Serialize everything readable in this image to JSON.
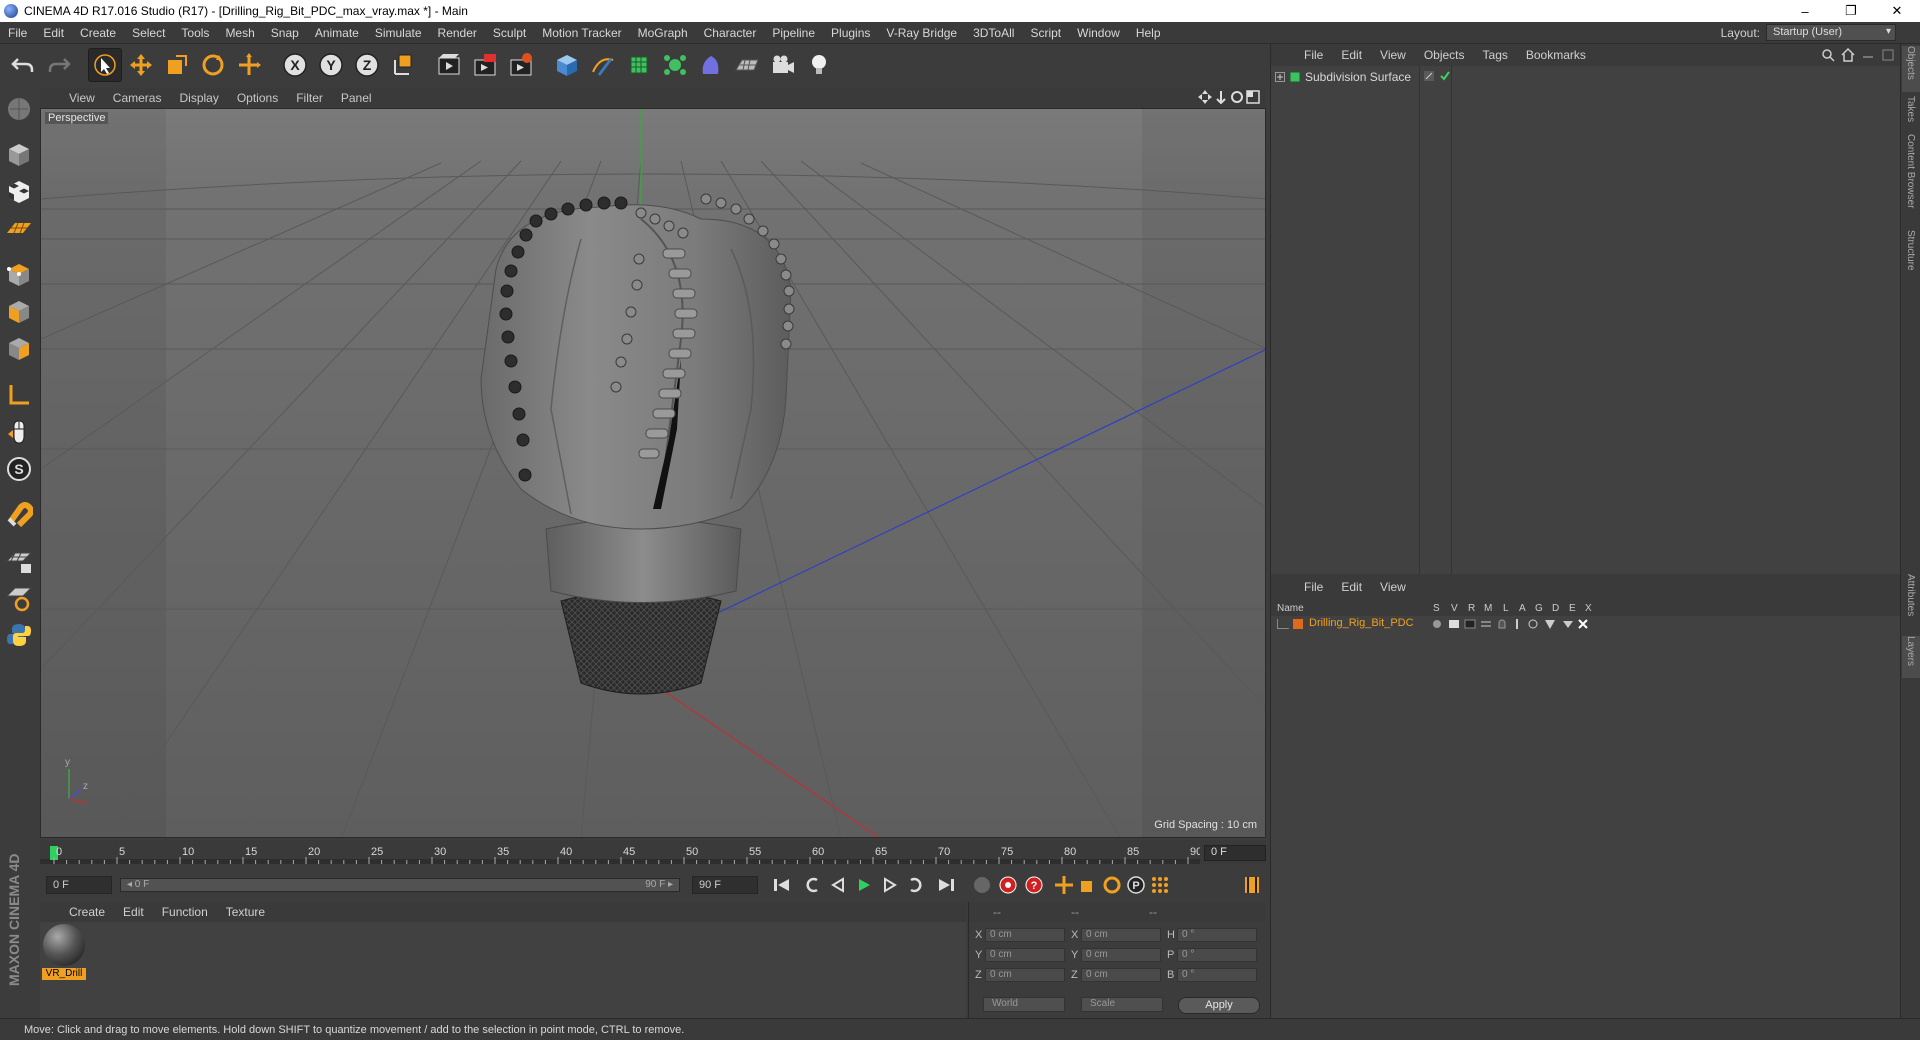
{
  "window": {
    "title": "CINEMA 4D R17.016 Studio (R17) - [Drilling_Rig_Bit_PDC_max_vray.max *] - Main",
    "minimize": "–",
    "maximize": "❐",
    "close": "✕"
  },
  "menubar": {
    "items": [
      "File",
      "Edit",
      "Create",
      "Select",
      "Tools",
      "Mesh",
      "Snap",
      "Animate",
      "Simulate",
      "Render",
      "Sculpt",
      "Motion Tracker",
      "MoGraph",
      "Character",
      "Pipeline",
      "Plugins",
      "V-Ray Bridge",
      "3DToAll",
      "Script",
      "Window",
      "Help"
    ],
    "layout_label": "Layout:",
    "layout_value": "Startup (User)"
  },
  "viewport": {
    "menu": [
      "View",
      "Cameras",
      "Display",
      "Options",
      "Filter",
      "Panel"
    ],
    "label": "Perspective",
    "grid_spacing": "Grid Spacing : 10 cm",
    "axis_y": "y",
    "axis_z": "z"
  },
  "timeline": {
    "ticks": [
      "0",
      "5",
      "10",
      "15",
      "20",
      "25",
      "30",
      "35",
      "40",
      "45",
      "50",
      "55",
      "60",
      "65",
      "70",
      "75",
      "80",
      "85",
      "90"
    ],
    "current_frame": "0 F",
    "start_field": "0 F",
    "range_start": "◂ 0 F",
    "range_end": "90 F ▸",
    "end_field": "90 F"
  },
  "material_manager": {
    "menu": [
      "Create",
      "Edit",
      "Function",
      "Texture"
    ],
    "materials": [
      {
        "name": "VR_Drill"
      }
    ]
  },
  "coordinates": {
    "header": [
      "--",
      "--",
      "--"
    ],
    "rows": [
      {
        "l1": "X",
        "v1": "0 cm",
        "l2": "X",
        "v2": "0 cm",
        "l3": "H",
        "v3": "0 °"
      },
      {
        "l1": "Y",
        "v1": "0 cm",
        "l2": "Y",
        "v2": "0 cm",
        "l3": "P",
        "v3": "0 °"
      },
      {
        "l1": "Z",
        "v1": "0 cm",
        "l2": "Z",
        "v2": "0 cm",
        "l3": "B",
        "v3": "0 °"
      }
    ],
    "space_select": "World",
    "mode_select": "Scale",
    "apply": "Apply"
  },
  "object_manager": {
    "menu": [
      "File",
      "Edit",
      "View",
      "Objects",
      "Tags",
      "Bookmarks"
    ],
    "objects": [
      {
        "name": "Subdivision Surface"
      }
    ]
  },
  "layer_manager": {
    "menu": [
      "File",
      "Edit",
      "View"
    ],
    "columns": [
      "Name",
      "S",
      "V",
      "R",
      "M",
      "L",
      "A",
      "G",
      "D",
      "E",
      "X"
    ],
    "layers": [
      {
        "name": "Drilling_Rig_Bit_PDC",
        "color": "#e06a1a"
      }
    ]
  },
  "side_tabs": [
    "Objects",
    "Takes",
    "Content Browser",
    "Structure",
    "Attributes",
    "Layers"
  ],
  "branding": {
    "text": "MAXON CINEMA 4D"
  },
  "status": {
    "text": "Move: Click and drag to move elements. Hold down SHIFT to quantize movement / add to the selection in point mode, CTRL to remove."
  },
  "colors": {
    "accent_orange": "#f0a020",
    "axis_x": "#c03030",
    "axis_y": "#30b030",
    "axis_z": "#3040c0"
  }
}
